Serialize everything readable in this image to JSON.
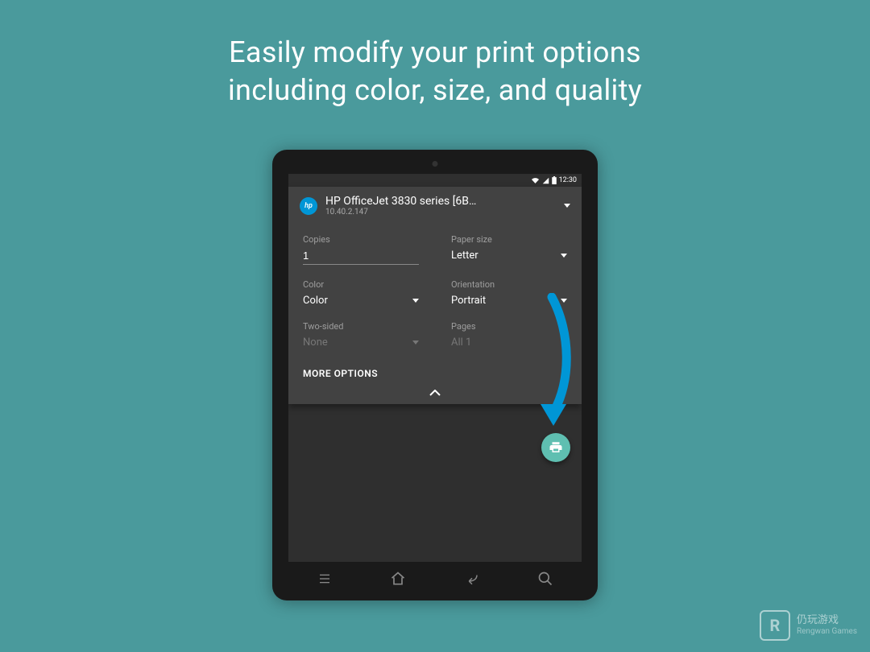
{
  "headline_line1": "Easily modify your print options",
  "headline_line2": "including color, size, and quality",
  "statusbar": {
    "time": "12:30"
  },
  "printer": {
    "name": "HP OfficeJet 3830 series [6B…",
    "ip": "10.40.2.147",
    "logo_text": "hp"
  },
  "options": {
    "copies": {
      "label": "Copies",
      "value": "1"
    },
    "paper_size": {
      "label": "Paper size",
      "value": "Letter"
    },
    "color": {
      "label": "Color",
      "value": "Color"
    },
    "orientation": {
      "label": "Orientation",
      "value": "Portrait"
    },
    "two_sided": {
      "label": "Two-sided",
      "value": "None"
    },
    "pages": {
      "label": "Pages",
      "value": "All 1"
    }
  },
  "more_options_label": "MORE OPTIONS",
  "fab": {
    "accent": "#5fbfb1"
  },
  "watermark": {
    "title": "仍玩游戏",
    "subtitle": "Rengwan Games"
  }
}
